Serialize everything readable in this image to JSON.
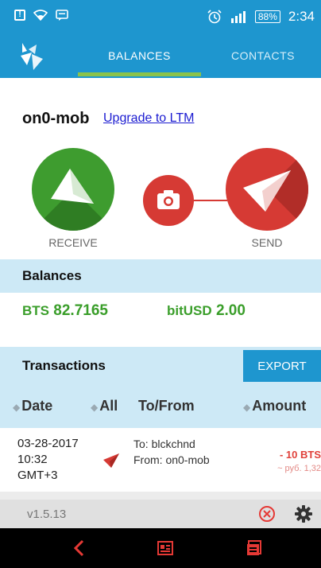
{
  "status_bar": {
    "battery": "88%",
    "time": "2:34"
  },
  "tabs": [
    {
      "label": "BALANCES",
      "active": true
    },
    {
      "label": "CONTACTS",
      "active": false
    }
  ],
  "account": {
    "name": "on0-mob",
    "upgrade_link": "Upgrade to LTM"
  },
  "actions": {
    "receive_label": "RECEIVE",
    "send_label": "SEND"
  },
  "balances": {
    "title": "Balances",
    "items": [
      {
        "symbol": "BTS",
        "amount": "82.7165"
      },
      {
        "symbol": "bitUSD",
        "amount": "2.00"
      }
    ]
  },
  "transactions": {
    "title": "Transactions",
    "export_label": "EXPORT",
    "columns": {
      "date": "Date",
      "all": "All",
      "to_from": "To/From",
      "amount": "Amount"
    },
    "rows": [
      {
        "date": "03-28-2017",
        "time": "10:32",
        "tz": "GMT+3",
        "to": "To: blckchnd",
        "from": "From: on0-mob",
        "amount": "- 10 BTS",
        "converted": "~ руб. 1,32"
      }
    ]
  },
  "footer": {
    "version": "v1.5.13"
  },
  "colors": {
    "primary": "#1e96cf",
    "accent_green": "#3e9c2f",
    "accent_red": "#d63a34",
    "section_bg": "#cde9f6",
    "tab_indicator": "#8bc34a",
    "nav_icons": "#e53935"
  },
  "icons": {
    "logo": "bitshares-logo-icon",
    "receive": "receive-arrow-icon",
    "camera": "camera-icon",
    "send": "send-arrow-icon",
    "close": "close-circle-icon",
    "settings": "gear-icon",
    "back": "back-icon",
    "home": "home-icon",
    "recent": "recent-apps-icon"
  }
}
